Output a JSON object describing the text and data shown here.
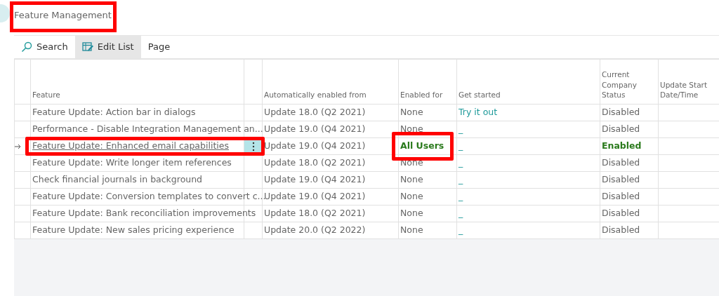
{
  "page": {
    "title": "Feature Management",
    "highlighted": true
  },
  "actions": [
    {
      "kind": "search",
      "label": "Search",
      "selected": false
    },
    {
      "kind": "edit-list",
      "label": "Edit List",
      "selected": true
    },
    {
      "kind": "plain",
      "label": "Page",
      "selected": false
    }
  ],
  "table": {
    "columns": [
      "Feature",
      "Automatically enabled from",
      "Enabled for",
      "Get started",
      "Current Company Status",
      "Update Start Date/Time"
    ],
    "rows": [
      {
        "feature": "Feature Update: Action bar in dialogs",
        "auto_enabled_from": "Update 18.0 (Q2 2021)",
        "enabled_for": "None",
        "get_started": "Try it out",
        "status": "Disabled",
        "enabled": false,
        "selected": false,
        "highlighted": false
      },
      {
        "feature": "Performance - Disable Integration Management an...",
        "auto_enabled_from": "Update 19.0 (Q4 2021)",
        "enabled_for": "None",
        "get_started": "_",
        "status": "Disabled",
        "enabled": false,
        "selected": false,
        "highlighted": false
      },
      {
        "feature": "Feature Update: Enhanced email capabilities",
        "auto_enabled_from": "Update 19.0 (Q4 2021)",
        "enabled_for": "All Users",
        "get_started": "_",
        "status": "Enabled",
        "enabled": true,
        "selected": true,
        "highlighted": true
      },
      {
        "feature": "Feature Update: Write longer item references",
        "auto_enabled_from": "Update 18.0 (Q2 2021)",
        "enabled_for": "None",
        "get_started": "_",
        "status": "Disabled",
        "enabled": false,
        "selected": false,
        "highlighted": false
      },
      {
        "feature": "Check financial journals in background",
        "auto_enabled_from": "Update 19.0 (Q4 2021)",
        "enabled_for": "None",
        "get_started": "_",
        "status": "Disabled",
        "enabled": false,
        "selected": false,
        "highlighted": false
      },
      {
        "feature": "Feature Update: Conversion templates to convert c...",
        "auto_enabled_from": "Update 19.0 (Q4 2021)",
        "enabled_for": "None",
        "get_started": "_",
        "status": "Disabled",
        "enabled": false,
        "selected": false,
        "highlighted": false
      },
      {
        "feature": "Feature Update: Bank reconciliation improvements",
        "auto_enabled_from": "Update 18.0 (Q2 2021)",
        "enabled_for": "None",
        "get_started": "_",
        "status": "Disabled",
        "enabled": false,
        "selected": false,
        "highlighted": false
      },
      {
        "feature": "Feature Update: New sales pricing experience",
        "auto_enabled_from": "Update 20.0 (Q2 2022)",
        "enabled_for": "None",
        "get_started": "_",
        "status": "Disabled",
        "enabled": false,
        "selected": false,
        "highlighted": false
      }
    ]
  }
}
